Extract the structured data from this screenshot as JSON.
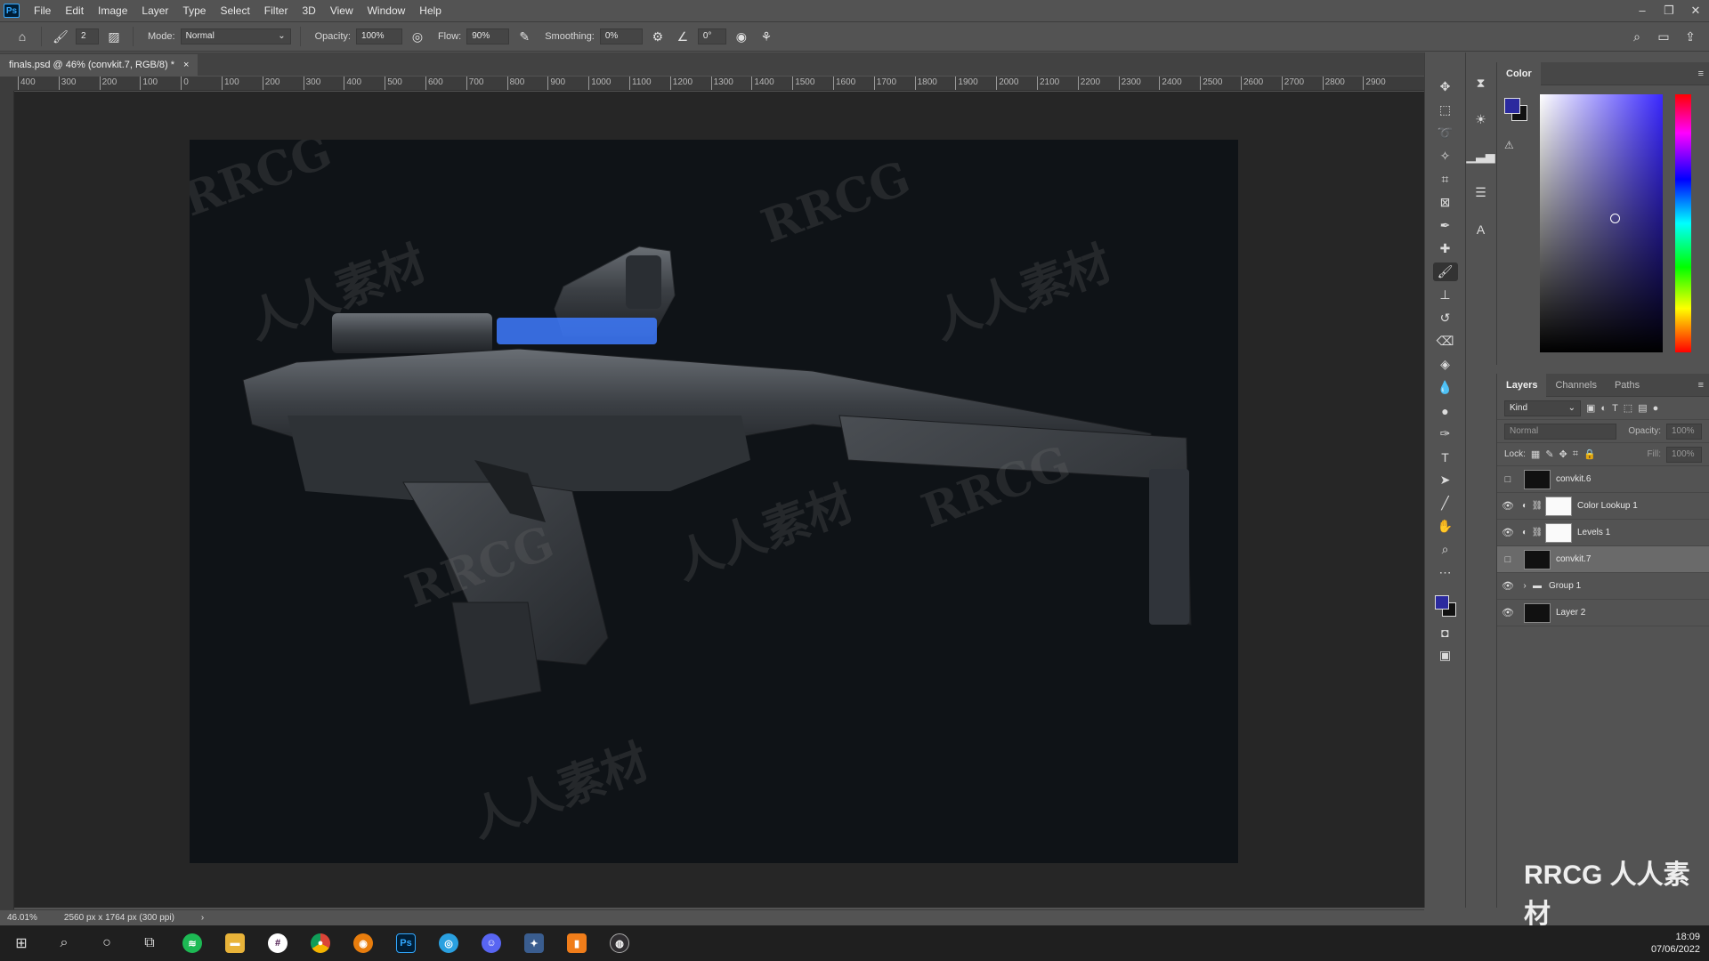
{
  "app": {
    "logo": "Ps",
    "menus": [
      "File",
      "Edit",
      "Image",
      "Layer",
      "Type",
      "Select",
      "Filter",
      "3D",
      "View",
      "Window",
      "Help"
    ]
  },
  "options": {
    "brush_size": "2",
    "mode_label": "Mode:",
    "mode_value": "Normal",
    "opacity_label": "Opacity:",
    "opacity_value": "100%",
    "flow_label": "Flow:",
    "flow_value": "90%",
    "smoothing_label": "Smoothing:",
    "smoothing_value": "0%",
    "angle_value": "0°"
  },
  "document": {
    "tab_title": "finals.psd @ 46% (convkit.7, RGB/8) *",
    "close": "×"
  },
  "ruler_ticks": [
    "400",
    "300",
    "200",
    "100",
    "0",
    "100",
    "200",
    "300",
    "400",
    "500",
    "600",
    "700",
    "800",
    "900",
    "1000",
    "1100",
    "1200",
    "1300",
    "1400",
    "1500",
    "1600",
    "1700",
    "1800",
    "1900",
    "2000",
    "2100",
    "2200",
    "2300",
    "2400",
    "2500",
    "2600",
    "2700",
    "2800",
    "2900"
  ],
  "watermarks": [
    "RRCG",
    "人人素材",
    "RRCG",
    "人人素材",
    "RRCG",
    "人人素材",
    "RRCG",
    "人人素材"
  ],
  "status": {
    "zoom": "46.01%",
    "doc_info": "2560 px x 1764 px (300 ppi)"
  },
  "color_panel": {
    "tab": "Color",
    "foreground": "#2b2a9e",
    "background": "#111111"
  },
  "layers_panel": {
    "tabs": [
      "Layers",
      "Channels",
      "Paths"
    ],
    "filter_kind": "Kind",
    "blend_mode": "Normal",
    "opacity_label": "Opacity:",
    "opacity_value": "100%",
    "lock_label": "Lock:",
    "fill_label": "Fill:",
    "fill_value": "100%",
    "layers": [
      {
        "name": "convkit.6",
        "visible": false,
        "type": "image"
      },
      {
        "name": "Color Lookup 1",
        "visible": true,
        "type": "adjustment"
      },
      {
        "name": "Levels 1",
        "visible": true,
        "type": "adjustment"
      },
      {
        "name": "convkit.7",
        "visible": false,
        "type": "image",
        "selected": true
      },
      {
        "name": "Group 1",
        "visible": true,
        "type": "group"
      },
      {
        "name": "Layer 2",
        "visible": true,
        "type": "fill"
      }
    ]
  },
  "taskbar": {
    "time": "18:09",
    "date": "07/06/2022",
    "apps": [
      "Spotify",
      "File Explorer",
      "Slack",
      "Chrome",
      "Blender",
      "Ps",
      "App",
      "Discord",
      "App",
      "App",
      "OBS"
    ]
  },
  "brand_overlay": "RRCG 人人素材"
}
